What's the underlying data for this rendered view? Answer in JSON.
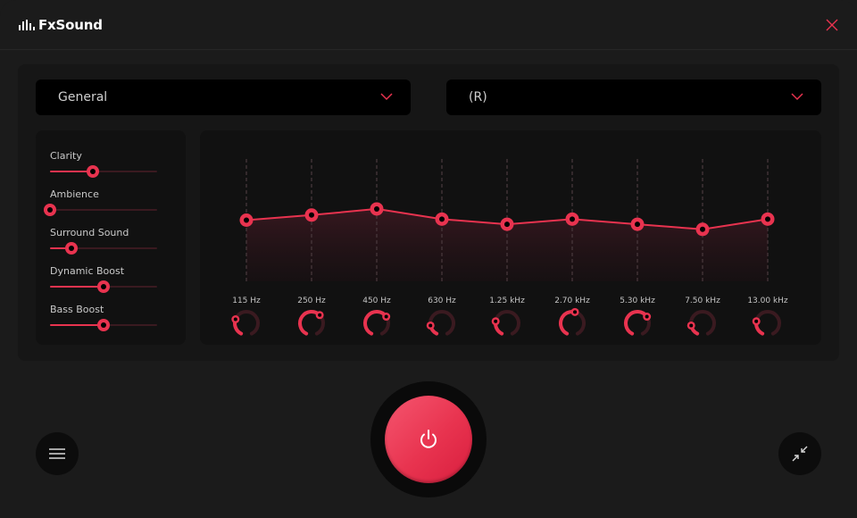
{
  "app": {
    "title": "FxSound",
    "logo_icon": "equalizer-bars-icon",
    "close_icon": "close-icon",
    "accent_color": "#e8334f",
    "track_color": "#3a1a20"
  },
  "presets": {
    "selected": "General",
    "chevron_icon": "chevron-down-icon"
  },
  "output_device": {
    "selected": "(R)",
    "chevron_icon": "chevron-down-icon"
  },
  "effects": [
    {
      "label": "Clarity",
      "value": 0.4
    },
    {
      "label": "Ambience",
      "value": 0.0
    },
    {
      "label": "Surround Sound",
      "value": 0.2
    },
    {
      "label": "Dynamic Boost",
      "value": 0.5
    },
    {
      "label": "Bass Boost",
      "value": 0.5
    }
  ],
  "equalizer": {
    "range_db": [
      -12,
      12
    ],
    "bands": [
      {
        "label": "115 Hz",
        "gain_db": 0.0,
        "knob": 0.15
      },
      {
        "label": "250 Hz",
        "gain_db": 1.0,
        "knob": 0.7
      },
      {
        "label": "450 Hz",
        "gain_db": 2.2,
        "knob": 0.75
      },
      {
        "label": "630 Hz",
        "gain_db": 0.2,
        "knob": 0.0
      },
      {
        "label": "1.25 kHz",
        "gain_db": -0.8,
        "knob": 0.1
      },
      {
        "label": "2.70 kHz",
        "gain_db": 0.2,
        "knob": 0.55
      },
      {
        "label": "5.30 kHz",
        "gain_db": -0.8,
        "knob": 0.75
      },
      {
        "label": "7.50 kHz",
        "gain_db": -1.8,
        "knob": 0.0
      },
      {
        "label": "13.00 kHz",
        "gain_db": 0.2,
        "knob": 0.1
      }
    ]
  },
  "controls": {
    "menu_icon": "hamburger-menu-icon",
    "power_icon": "power-icon",
    "power_on": true,
    "minimize_icon": "collapse-arrows-icon"
  }
}
